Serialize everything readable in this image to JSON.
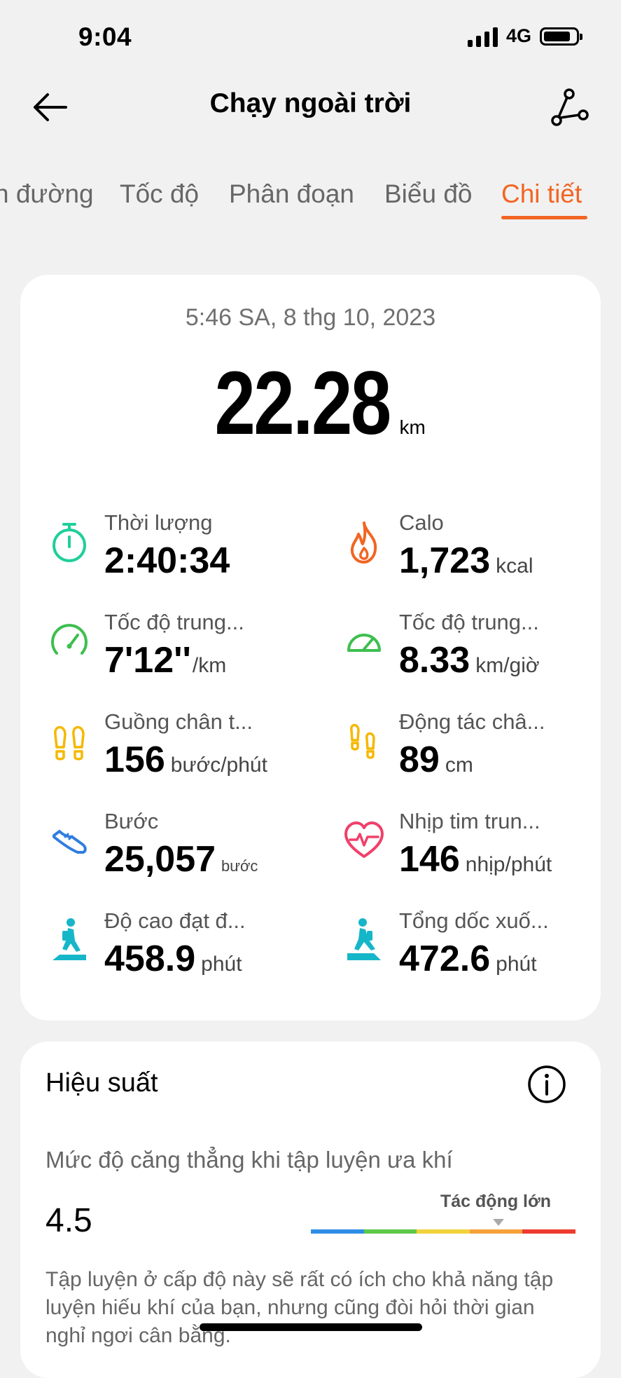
{
  "status": {
    "time": "9:04",
    "network": "4G",
    "battery_level": 0.85
  },
  "nav": {
    "title": "Chạy ngoài trời"
  },
  "tabs": [
    {
      "label": "n đường"
    },
    {
      "label": "Tốc độ"
    },
    {
      "label": "Phân đoạn"
    },
    {
      "label": "Biểu đồ"
    },
    {
      "label": "Chi tiết",
      "active": true
    }
  ],
  "summary": {
    "date": "5:46 SA, 8 thg 10, 2023",
    "distance": "22.28",
    "distance_unit": "km"
  },
  "stats": [
    {
      "label": "Thời lượng",
      "value": "2:40:34",
      "unit": "",
      "icon": "stopwatch-icon",
      "color": "#1fcf9a"
    },
    {
      "label": "Calo",
      "value": "1,723",
      "unit": "kcal",
      "icon": "flame-icon",
      "color": "#f26522"
    },
    {
      "label": "Tốc độ trung...",
      "value": "7'12''",
      "unit": "/km",
      "icon": "speedometer-icon",
      "color": "#3dbf4f"
    },
    {
      "label": "Tốc độ trung...",
      "value": "8.33",
      "unit": "km/giờ",
      "icon": "speedometer-icon",
      "color": "#3dbf4f"
    },
    {
      "label": "Guồng chân t...",
      "value": "156",
      "unit": "bước/phút",
      "icon": "footprints-icon",
      "color": "#f5b800"
    },
    {
      "label": "Động tác châ...",
      "value": "89",
      "unit": "cm",
      "icon": "footprints-stride-icon",
      "color": "#f5b800"
    },
    {
      "label": "Bước",
      "value": "25,057",
      "unit": "bước",
      "icon": "shoe-icon",
      "color": "#2f7de1"
    },
    {
      "label": "Nhịp tim trun...",
      "value": "146",
      "unit": "nhịp/phút",
      "icon": "heart-rate-icon",
      "color": "#f0406a"
    },
    {
      "label": "Độ cao đạt đ...",
      "value": "458.9",
      "unit": "phút",
      "icon": "hiker-uphill-icon",
      "color": "#16b6c9"
    },
    {
      "label": "Tổng dốc xuố...",
      "value": "472.6",
      "unit": "phút",
      "icon": "hiker-downhill-icon",
      "color": "#16b6c9"
    }
  ],
  "performance": {
    "title": "Hiệu suất",
    "subtitle": "Mức độ căng thẳng khi tập luyện ưa khí",
    "value": "4.5",
    "impact_label": "Tác động lớn",
    "scale_colors": [
      "#2f8de6",
      "#5ec84a",
      "#f2d23a",
      "#f6a13a",
      "#ee3a2f"
    ],
    "description": "Tập luyện ở cấp độ này sẽ rất có ích cho khả năng tập luyện hiếu khí của bạn, nhưng cũng đòi hỏi thời gian nghỉ ngơi cân bằng."
  }
}
